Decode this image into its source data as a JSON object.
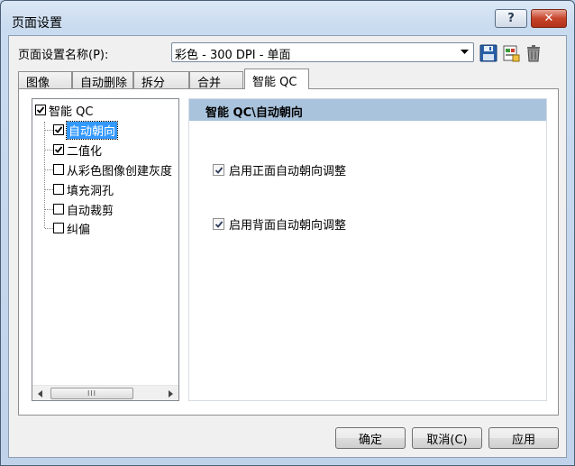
{
  "window": {
    "title": "页面设置"
  },
  "titlebar": {
    "help_label": "?",
    "close_label": "✕"
  },
  "profile": {
    "label": "页面设置名称(P):",
    "value": "彩色 - 300 DPI - 单面"
  },
  "toolbar": {
    "save_icon": "save-icon",
    "settings_icon": "settings-icon",
    "delete_icon": "trash-icon"
  },
  "tabs": [
    {
      "label": "图像",
      "active": false
    },
    {
      "label": "自动删除",
      "active": false
    },
    {
      "label": "拆分",
      "active": false
    },
    {
      "label": "合并",
      "active": false
    },
    {
      "label": "智能 QC",
      "active": true
    }
  ],
  "tree": {
    "root": {
      "label": "智能 QC",
      "checked": true
    },
    "items": [
      {
        "label": "自动朝向",
        "checked": true,
        "selected": true
      },
      {
        "label": "二值化",
        "checked": true,
        "selected": false
      },
      {
        "label": "从彩色图像创建灰度",
        "checked": false,
        "selected": false
      },
      {
        "label": "填充洞孔",
        "checked": false,
        "selected": false
      },
      {
        "label": "自动裁剪",
        "checked": false,
        "selected": false
      },
      {
        "label": "纠偏",
        "checked": false,
        "selected": false
      }
    ],
    "scroll_thumb_label": "III"
  },
  "detail": {
    "header": "智能 QC\\自动朝向",
    "options": [
      {
        "label": "启用正面自动朝向调整",
        "checked": true
      },
      {
        "label": "启用背面自动朝向调整",
        "checked": true
      }
    ]
  },
  "buttons": {
    "ok": "确定",
    "cancel": "取消(C)",
    "apply": "应用"
  },
  "colors": {
    "header_bg": "#a9c3dd",
    "selection": "#3399ff",
    "close_button": "#c6442a"
  }
}
